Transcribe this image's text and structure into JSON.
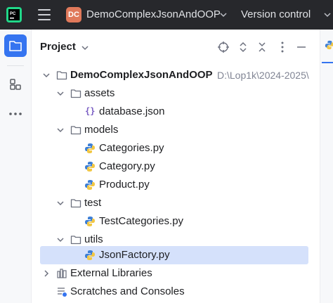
{
  "titlebar": {
    "project_badge": "DC",
    "project_name": "DemoComplexJsonAndOOP",
    "vcs_label": "Version control"
  },
  "panel": {
    "title": "Project"
  },
  "tree": {
    "root": {
      "label": "DemoComplexJsonAndOOP",
      "path": "D:\\Lop1k\\2024-2025\\"
    },
    "assets": {
      "label": "assets"
    },
    "database_json": {
      "label": "database.json",
      "icon": "{}"
    },
    "models": {
      "label": "models"
    },
    "categories_py": {
      "label": "Categories.py"
    },
    "category_py": {
      "label": "Category.py"
    },
    "product_py": {
      "label": "Product.py"
    },
    "test": {
      "label": "test"
    },
    "testcategories_py": {
      "label": "TestCategories.py"
    },
    "utils": {
      "label": "utils"
    },
    "jsonfactory_py": {
      "label": "JsonFactory.py"
    },
    "external_libraries": {
      "label": "External Libraries"
    },
    "scratches": {
      "label": "Scratches and Consoles"
    }
  },
  "colors": {
    "titlebar_bg": "#27282c",
    "accent": "#3574f0",
    "selection": "#d5e1fb",
    "project_badge": "#e0795b"
  }
}
